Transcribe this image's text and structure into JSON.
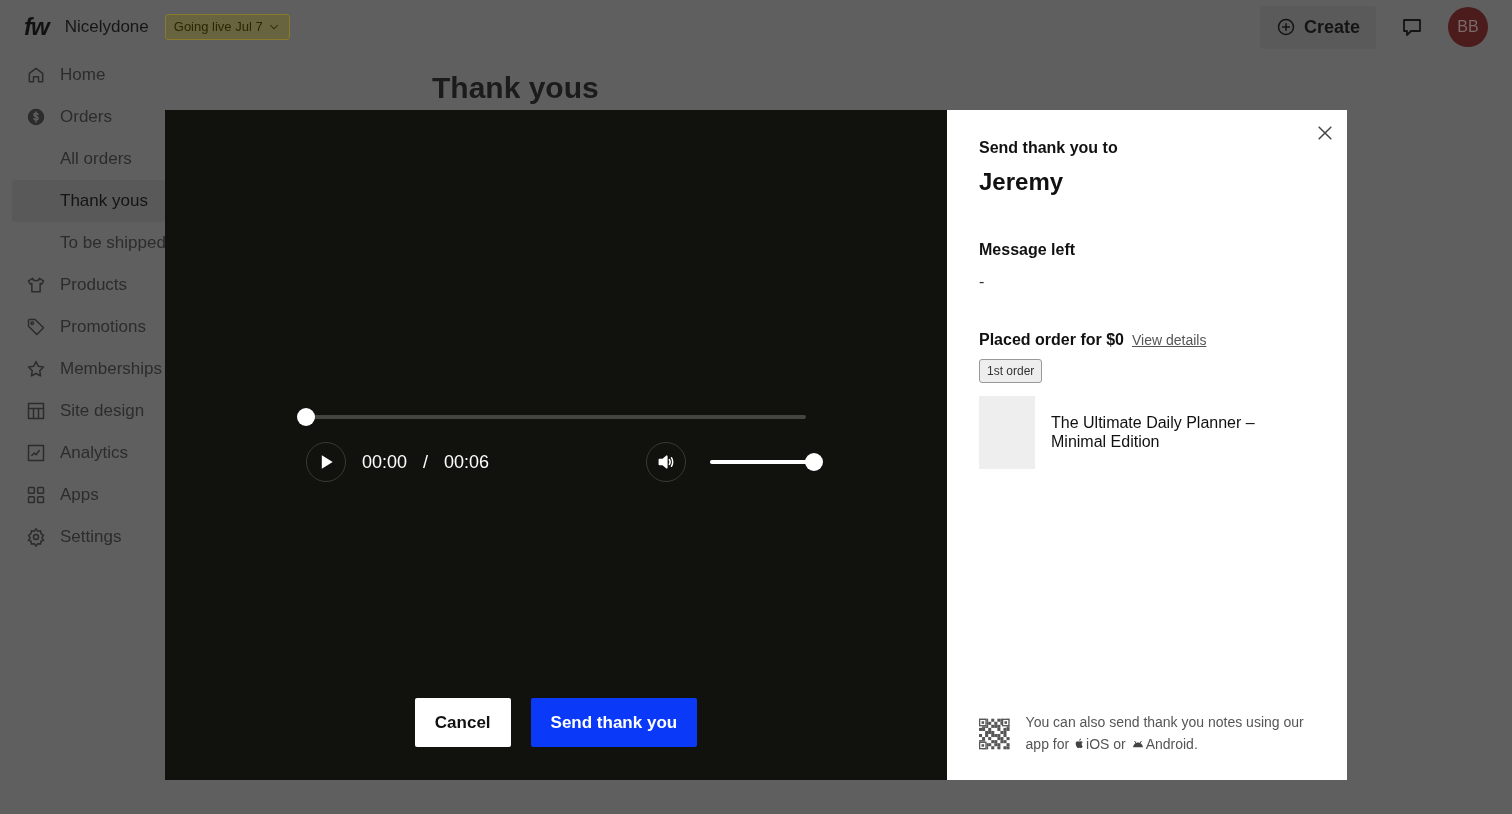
{
  "app": {
    "logo": "fw",
    "store": "Nicelydone",
    "status_badge": "Going live Jul 7",
    "create_button": "Create",
    "avatar": "BB"
  },
  "sidebar": {
    "items": [
      {
        "label": "Home",
        "selected": false
      },
      {
        "label": "Orders",
        "selected": false,
        "children": [
          {
            "label": "All orders",
            "selected": false
          },
          {
            "label": "Thank yous",
            "selected": true
          },
          {
            "label": "To be shipped",
            "selected": false
          }
        ]
      },
      {
        "label": "Products",
        "selected": false
      },
      {
        "label": "Promotions",
        "selected": false
      },
      {
        "label": "Memberships",
        "selected": false
      },
      {
        "label": "Site design",
        "selected": false
      },
      {
        "label": "Analytics",
        "selected": false
      },
      {
        "label": "Apps",
        "selected": false
      },
      {
        "label": "Settings",
        "selected": false
      }
    ]
  },
  "page": {
    "title": "Thank yous"
  },
  "player": {
    "playing": false,
    "progress": {
      "level": 0
    },
    "current_time": "00:00",
    "separator": "/",
    "duration": "00:06",
    "volume": {
      "level": 1
    }
  },
  "actions": [
    {
      "label": "Cancel",
      "kind": "secondary"
    },
    {
      "label": "Send thank you",
      "kind": "primary"
    }
  ],
  "details": {
    "heading": "Send thank you to",
    "recipient": "Jeremy",
    "message_label": "Message left",
    "message": "-",
    "order_text": "Placed order for $0",
    "order_link": "View details",
    "order_tag": "1st order",
    "product": {
      "title": "The Ultimate Daily Planner – Minimal Edition"
    },
    "app_note": {
      "text": "You can also send thank you notes using our app for",
      "ios": "iOS",
      "joiner": "or",
      "android": "Android",
      "end": "."
    }
  }
}
